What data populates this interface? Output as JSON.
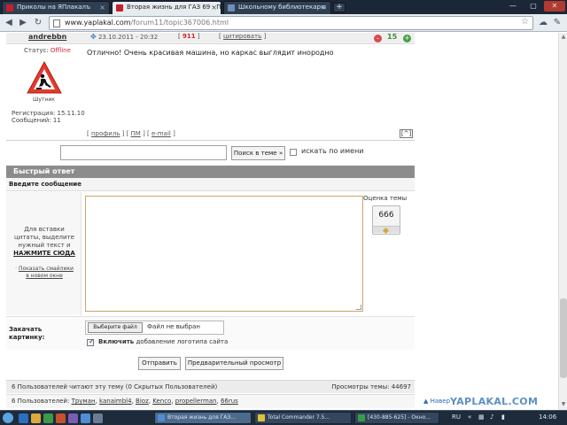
{
  "browser": {
    "tabs": [
      {
        "label": "Приколы на ЯПлакалъ"
      },
      {
        "label": "Вторая жизнь для ГАЗ 69 - П"
      },
      {
        "label": "Школьному библиотекарю"
      }
    ],
    "url_domain": "www.yaplakal.com",
    "url_path": "/forum11/topic367006.html"
  },
  "post": {
    "author": "andrebbn",
    "date": "23.10.2011 - 20:32",
    "number": "911",
    "cite_label": "цитировать",
    "karma": "15",
    "status_label": "Статус:",
    "status_value": "Offline",
    "avatar_caption": "Шутник",
    "registration": "Регистрация: 15.11.10",
    "messages": "Сообщений: 11",
    "text": "Отлично! Очень красивая машина, но каркас выглядит инородно",
    "link_profile": "профиль",
    "link_pm": "ПМ",
    "link_email": "e-mail",
    "top_arrow": "^"
  },
  "search": {
    "button": "Поиск в теме »",
    "by_name_label": "искать по имени"
  },
  "reply": {
    "quick_title": "Быстрый ответ",
    "enter_message": "Введите сообщение",
    "help_line1": "Для вставки",
    "help_line2": "цитаты, выделите",
    "help_line3": "нужный текст и",
    "help_link": "НАЖМИТЕ СЮДА",
    "smileys_link": "Показать смайлики",
    "smileys_link2": "в новом окне",
    "rating_label": "Оценка темы",
    "rating_value": "666",
    "upload_label1": "Закачать",
    "upload_label2": "картинку:",
    "file_button": "Выберите файл",
    "file_none": "Файл не выбран",
    "logo_bold": "Включить",
    "logo_rest": "добавление логотипа сайта",
    "send_button": "Отправить",
    "preview_button": "Предварительный просмотр"
  },
  "footer": {
    "readers": "6 Пользователей читают эту тему (0 Скрытых Пользователей)",
    "views": "Просмотры темы: 44697",
    "users_prefix": "6 Пользователей:",
    "users": [
      "Труман",
      "kanaimbl4",
      "Bioz",
      "Kenco",
      "propellerman",
      "66rus"
    ],
    "nav_link": "Навер",
    "watermark": "YAPLAKAL.COM"
  },
  "taskbar": {
    "tasks": [
      {
        "label": "Вторая жизнь для ГАЗ..."
      },
      {
        "label": "Total Commander 7.5..."
      },
      {
        "label": "[430-885-625] - Окно..."
      }
    ],
    "lang": "RU",
    "time": "14:06"
  },
  "colors": {
    "accent_red": "#d0232c",
    "karma_green": "#3b8f3b",
    "link_blue": "#2d6db3",
    "header_gray": "#8c8c8c"
  }
}
